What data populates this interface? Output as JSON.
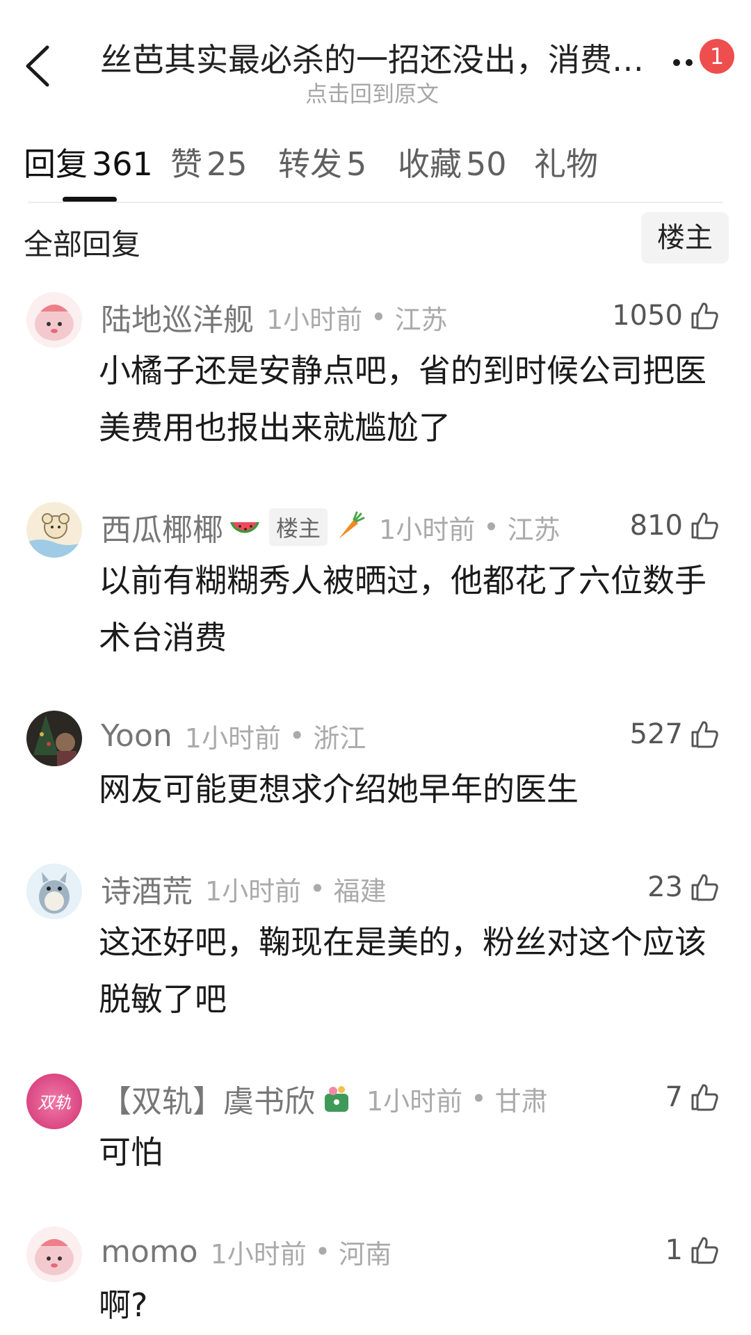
{
  "header": {
    "title": "丝芭其实最必杀的一招还没出，消费…",
    "subtitle": "点击回到原文",
    "notification_count": "1"
  },
  "tabs": [
    {
      "label": "回复",
      "count": "361"
    },
    {
      "label": "赞",
      "count": "25"
    },
    {
      "label": "转发",
      "count": "5"
    },
    {
      "label": "收藏",
      "count": "50"
    },
    {
      "label": "礼物",
      "count": ""
    }
  ],
  "filter": {
    "section_title": "全部回复",
    "owner_button": "楼主"
  },
  "comments": [
    {
      "username": "陆地巡洋舰",
      "time": "1小时前",
      "region": "江苏",
      "likes": "1050",
      "text": "小橘子还是安静点吧，省的到时候公司把医美费用也报出来就尴尬了",
      "avatar": "pink-blob-avatar"
    },
    {
      "username": "西瓜椰椰",
      "owner_tag": "楼主",
      "time": "1小时前",
      "region": "江苏",
      "likes": "810",
      "text": "以前有糊糊秀人被晒过，他都花了六位数手术台消费",
      "avatar": "koala-avatar",
      "emoji_after_name": "watermelon-icon",
      "emoji_after_tag": "carrot-icon"
    },
    {
      "username": "Yoon",
      "time": "1小时前",
      "region": "浙江",
      "likes": "527",
      "text": "网友可能更想求介绍她早年的医生",
      "avatar": "christmas-photo-avatar"
    },
    {
      "username": "诗酒荒",
      "time": "1小时前",
      "region": "福建",
      "likes": "23",
      "text": "这还好吧，鞠现在是美的，粉丝对这个应该脱敏了吧",
      "avatar": "totoro-avatar"
    },
    {
      "username": "【双轨】虞书欣",
      "time": "1小时前",
      "region": "甘肃",
      "likes": "7",
      "text": "可怕",
      "avatar": "shuanggui-text-avatar",
      "avatar_text": "双轨",
      "emoji_after_name": "flower-bird-icon"
    },
    {
      "username": "momo",
      "time": "1小时前",
      "region": "河南",
      "likes": "1",
      "text": "啊?",
      "avatar": "pink-blob-avatar"
    }
  ],
  "colors": {
    "badge": "#ee4e4e",
    "meta_gray": "#aaaaaa",
    "username_gray": "#777777",
    "tab_indicator": "#111111"
  }
}
